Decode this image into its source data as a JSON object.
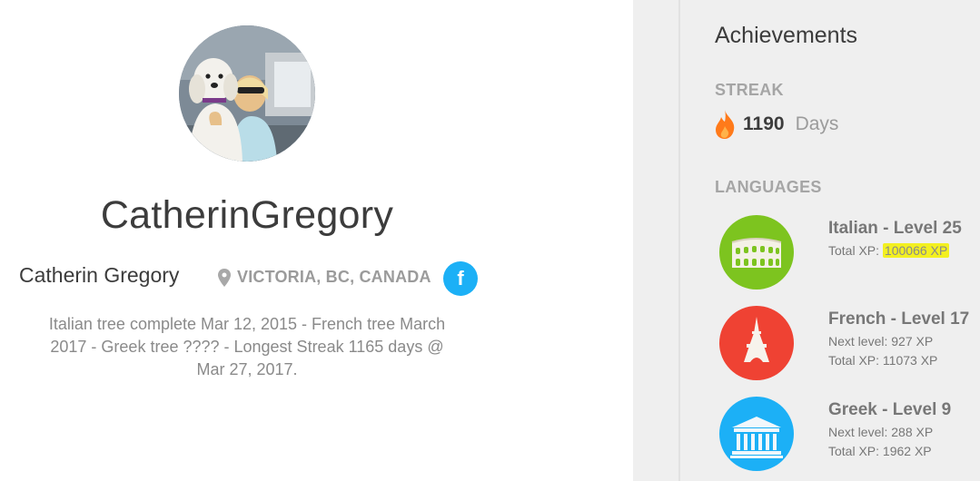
{
  "profile": {
    "username": "CatherinGregory",
    "full_name": "Catherin Gregory",
    "location": "VICTORIA, BC, CANADA",
    "facebook_label": "f",
    "bio": "Italian tree complete Mar 12, 2015 - French tree March 2017 - Greek tree ???? - Longest Streak 1165 days @ Mar 27, 2017.",
    "avatar_icon": "profile-photo",
    "location_icon": "map-pin-icon"
  },
  "achievements": {
    "title": "Achievements",
    "streak_label": "STREAK",
    "streak_value": "1190",
    "streak_unit": "Days",
    "streak_icon": "flame-icon",
    "languages_label": "LANGUAGES",
    "languages": [
      {
        "title": "Italian - Level 25",
        "total_prefix": "Total XP:",
        "total_value": "100066 XP",
        "color": "#7dc41f",
        "icon": "colosseum-icon"
      },
      {
        "title": "French - Level 17",
        "next_level": "Next level: 927 XP",
        "total_line": "Total XP: 11073 XP",
        "color": "#ef4233",
        "icon": "eiffel-tower-icon"
      },
      {
        "title": "Greek - Level 9",
        "next_level": "Next level: 288 XP",
        "total_line": "Total XP: 1962 XP",
        "color": "#1cb0f6",
        "icon": "parthenon-icon"
      }
    ]
  },
  "colors": {
    "accent_blue": "#1cb0f6",
    "flame": "#ff7a1a",
    "highlight": "#f3f020",
    "sidebar_bg": "#efefef"
  }
}
